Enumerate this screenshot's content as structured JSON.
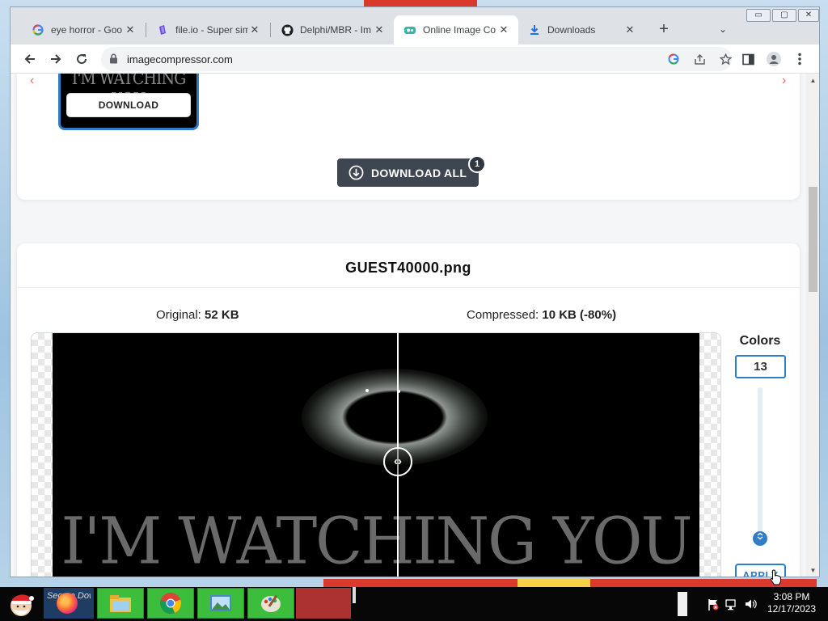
{
  "browser": {
    "tabs": [
      {
        "title": "eye horror - Goo",
        "icon": "google-icon"
      },
      {
        "title": "file.io - Super sim",
        "icon": "fileio-icon"
      },
      {
        "title": "Delphi/MBR - Im",
        "icon": "github-icon"
      },
      {
        "title": "Online Image Co",
        "icon": "imagecompressor-icon",
        "active": true
      },
      {
        "title": "Downloads",
        "icon": "download-icon"
      }
    ],
    "close_glyph": "✕",
    "new_tab_glyph": "+",
    "tab_search_glyph": "⌄",
    "url": "imagecompressor.com",
    "window_controls": [
      "▭",
      "▢",
      "✕"
    ]
  },
  "page": {
    "thumb_caption": "I'M WATCHING YOU",
    "thumb_download_label": "DOWNLOAD",
    "download_all_label": "DOWNLOAD ALL",
    "download_all_badge": "1",
    "file_name": "GUEST40000.png",
    "original_label": "Original:",
    "original_value": "52 KB",
    "compressed_label": "Compressed:",
    "compressed_value": "10 KB (-80%)",
    "image_caption": "I'M WATCHING YOU",
    "colors_label": "Colors",
    "colors_value": "13",
    "apply_label": "APPLY",
    "compare_handle": "‹›"
  },
  "taskbar": {
    "time": "3:08 PM",
    "date": "12/17/2023",
    "hidden_window_title": "Secure Dow"
  },
  "colors": {
    "accent": "#2f7cc9",
    "dark_button": "#3e4652",
    "taskbar_green": "#3cbd3c"
  }
}
